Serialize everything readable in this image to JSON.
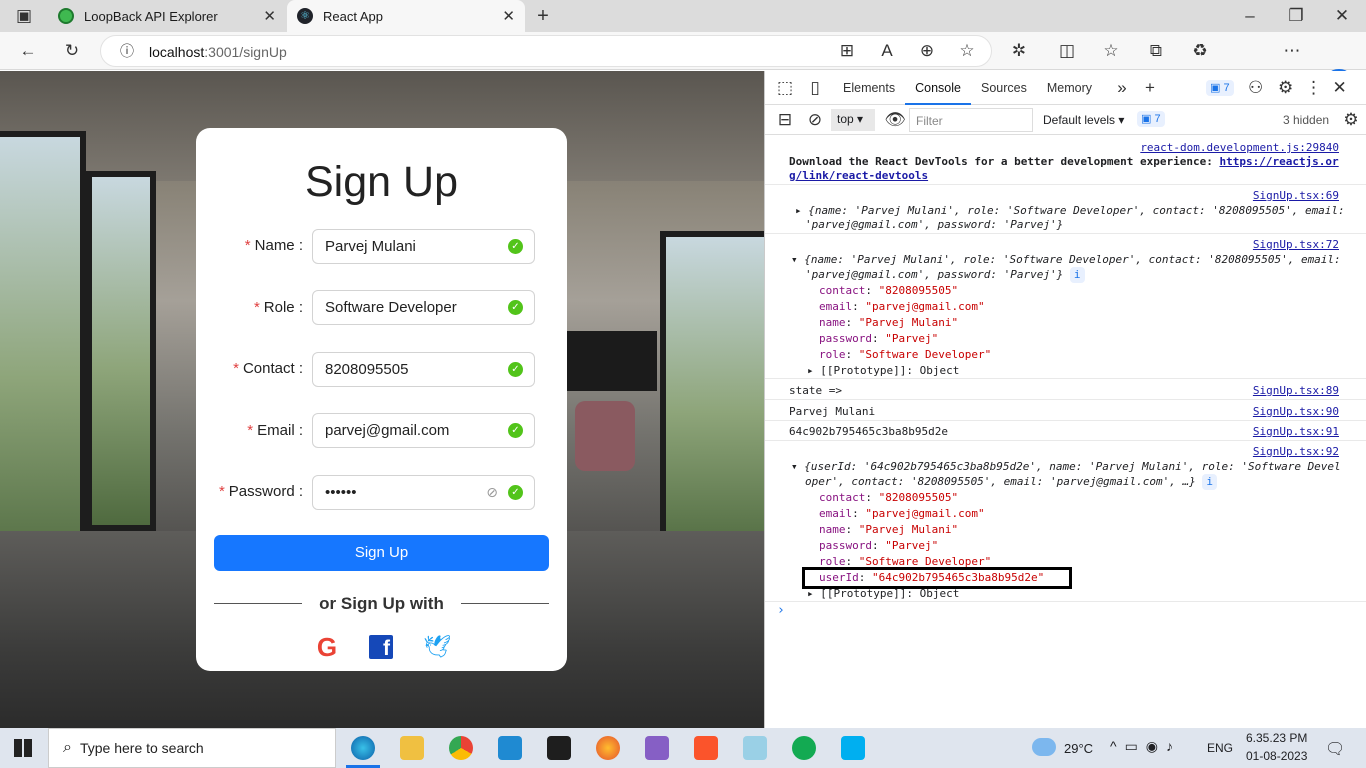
{
  "browser": {
    "tabs": [
      {
        "label": "LoopBack API Explorer",
        "active": false
      },
      {
        "label": "React App",
        "active": true
      }
    ],
    "url_host": "localhost",
    "url_rest": ":3001/signUp"
  },
  "form": {
    "title": "Sign Up",
    "fields": [
      {
        "label": "Name",
        "value": "Parvej Mulani"
      },
      {
        "label": "Role",
        "value": "Software Developer"
      },
      {
        "label": "Contact",
        "value": "8208095505"
      },
      {
        "label": "Email",
        "value": "parvej@gmail.com"
      },
      {
        "label": "Password",
        "value": "••••••"
      }
    ],
    "required_mark": "*",
    "submit_label": "Sign Up",
    "divider_text": "or Sign Up with",
    "social": [
      "google-icon",
      "facebook-icon",
      "twitter-icon"
    ],
    "accent": "#1677ff"
  },
  "devtools": {
    "tabs": [
      "Elements",
      "Console",
      "Sources",
      "Memory"
    ],
    "active_tab": "Console",
    "issues_count": "7",
    "context": "top",
    "filter_placeholder": "Filter",
    "levels": "Default levels",
    "hidden": "3 hidden",
    "messages": {
      "devtools_src": "react-dom.development.js:29840",
      "devtools_text": "Download the React DevTools for a better development experience: ",
      "devtools_link1": "https://reactjs.or",
      "devtools_link2": "g/link/react-devtools",
      "obj1_src": "SignUp.tsx:69",
      "obj1_l1": "{name: 'Parvej Mulani', role: 'Software Developer', contact: '8208095505', email:",
      "obj1_l2": "'parvej@gmail.com', password: 'Parvej'}",
      "obj2_src": "SignUp.tsx:72",
      "obj2_l1": "{name: 'Parvej Mulani', role: 'Software Developer', contact: '8208095505', email:",
      "obj2_l2": "'parvej@gmail.com', password: 'Parvej'}",
      "props1": [
        {
          "k": "contact",
          "v": "\"8208095505\""
        },
        {
          "k": "email",
          "v": "\"parvej@gmail.com\""
        },
        {
          "k": "name",
          "v": "\"Parvej Mulani\""
        },
        {
          "k": "password",
          "v": "\"Parvej\""
        },
        {
          "k": "role",
          "v": "\"Software Developer\""
        }
      ],
      "proto": "[[Prototype]]: Object",
      "state_text": "state =>",
      "state_src": "SignUp.tsx:89",
      "name_text": "Parvej Mulani",
      "name_src": "SignUp.tsx:90",
      "id_text": "64c902b795465c3ba8b95d2e",
      "id_src": "SignUp.tsx:91",
      "obj3_src": "SignUp.tsx:92",
      "obj3_l1": "{userId: '64c902b795465c3ba8b95d2e', name: 'Parvej Mulani', role: 'Software Devel",
      "obj3_l2": "oper', contact: '8208095505', email: 'parvej@gmail.com', …}",
      "props2": [
        {
          "k": "contact",
          "v": "\"8208095505\""
        },
        {
          "k": "email",
          "v": "\"parvej@gmail.com\""
        },
        {
          "k": "name",
          "v": "\"Parvej Mulani\""
        },
        {
          "k": "password",
          "v": "\"Parvej\""
        },
        {
          "k": "role",
          "v": "\"Software Developer\""
        },
        {
          "k": "userId",
          "v": "\"64c902b795465c3ba8b95d2e\""
        }
      ]
    }
  },
  "taskbar": {
    "search_placeholder": "Type here to search",
    "weather": "29°C",
    "lang": "ENG",
    "time": "6.35.23 PM",
    "date": "01-08-2023"
  }
}
